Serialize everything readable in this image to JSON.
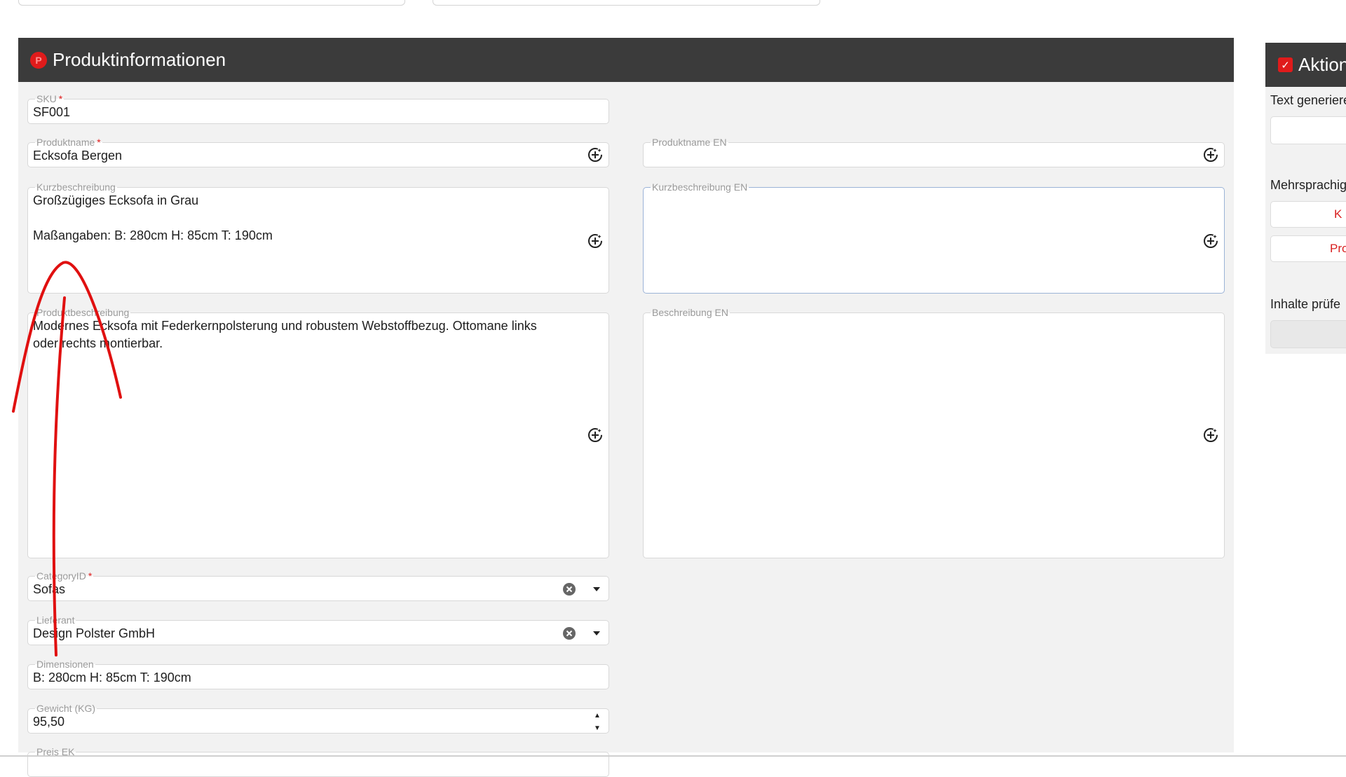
{
  "main": {
    "title": "Produktinformationen",
    "fields": {
      "sku": {
        "label": "SKU",
        "required": "*",
        "value": "SF001"
      },
      "produktname": {
        "label": "Produktname",
        "required": "*",
        "value": "Ecksofa Bergen"
      },
      "produktname_en": {
        "label": "Produktname EN",
        "value": ""
      },
      "kurzbeschreibung": {
        "label": "Kurzbeschreibung",
        "value": "Großzügiges Ecksofa in Grau\n\nMaßangaben: B: 280cm H: 85cm T: 190cm"
      },
      "kurzbeschreibung_en": {
        "label": "Kurzbeschreibung EN",
        "value": ""
      },
      "produktbeschreibung": {
        "label": "Produktbeschreibung",
        "value": "Modernes Ecksofa mit Federkernpolsterung und robustem Webstoffbezug. Ottomane links\noder rechts montierbar."
      },
      "beschreibung_en": {
        "label": "Beschreibung EN",
        "value": ""
      },
      "category": {
        "label": "CategoryID",
        "required": "*",
        "value": "Sofas"
      },
      "lieferant": {
        "label": "Lieferant",
        "value": "Design Polster GmbH"
      },
      "dimensionen": {
        "label": "Dimensionen",
        "value": "B: 280cm H: 85cm T: 190cm"
      },
      "gewicht": {
        "label": "Gewicht (KG)",
        "value": "95,50"
      },
      "preis_ek": {
        "label": "Preis EK"
      }
    }
  },
  "side": {
    "title": "Aktion",
    "text_generieren_label": "Text generiere",
    "mehrsprachig_label": "Mehrsprachig",
    "button_k": "K",
    "button_pro": "Pro",
    "inhalte_pruefen_label": "Inhalte prüfe"
  },
  "icons": {
    "ai_generate": "sparkle-plus-icon",
    "clear": "clear-circle-icon",
    "dropdown": "caret-down-icon",
    "spinner": "number-spinner-icon",
    "header_p": "p-logo-icon",
    "header_check": "checkbox-icon"
  },
  "colors": {
    "header_bg": "#3b3b3b",
    "accent": "#e01b1b",
    "card_bg": "#f2f2f2",
    "annotation": "#e01010"
  }
}
